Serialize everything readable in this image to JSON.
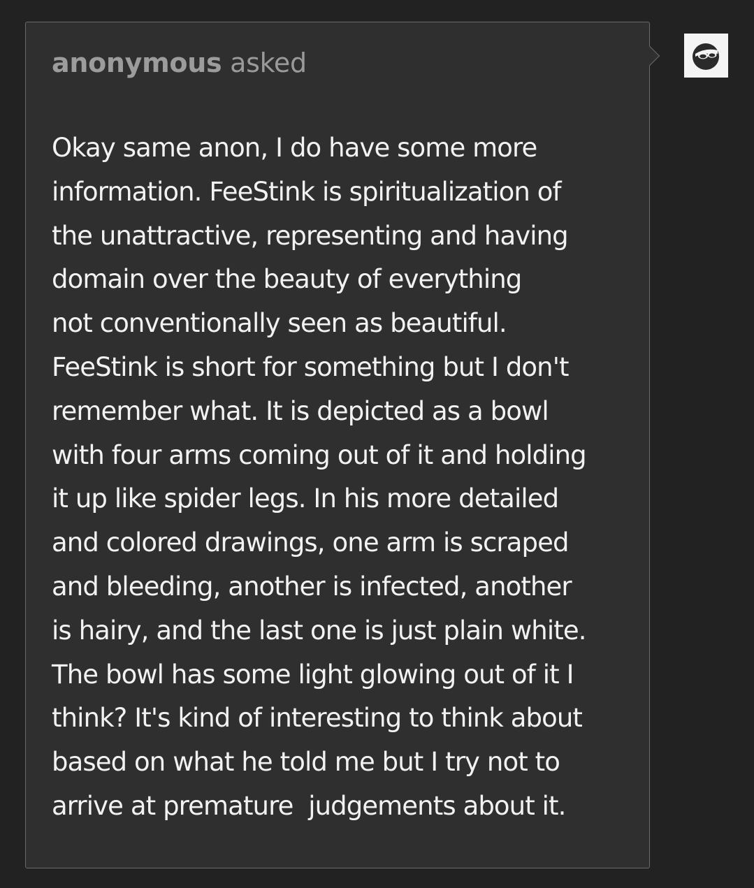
{
  "ask": {
    "asker": "anonymous",
    "verb": "asked",
    "lines": [
      "Okay same anon, I do have some more",
      "information. FeeStink is spiritualization of",
      "the unattractive, representing and having",
      "domain over the beauty of everything",
      "not conventionally seen as beautiful.",
      "FeeStink is short for something but I don't",
      "remember what. It is depicted as a bowl",
      "with four arms coming out of it and holding",
      "it up like spider legs. In his more detailed",
      "and colored drawings, one arm is scraped",
      "and bleeding, another is infected, another",
      "is hairy, and the last one is just plain white.",
      "The bowl has some light glowing out of it I",
      "think? It's kind of interesting to think about",
      "based on what he told me but I try not to",
      "arrive at premature  judgements about it."
    ]
  },
  "avatar": {
    "icon": "sunglasses-face-icon"
  },
  "colors": {
    "page_background": "#222222",
    "card_background": "#2f2f2f",
    "card_border": "#6a6a6a",
    "header_text": "#9a9a9a",
    "body_text": "#f2f2f2",
    "avatar_background": "#f4f4f4"
  }
}
